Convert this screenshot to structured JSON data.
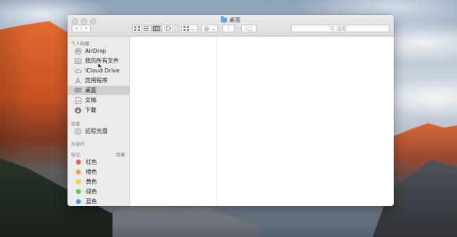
{
  "window": {
    "title": "桌面",
    "search_placeholder": "搜索"
  },
  "toolbar": {
    "back_glyph": "‹",
    "forward_glyph": "›",
    "view_modes": [
      "icon",
      "list",
      "column",
      "cover-flow"
    ],
    "active_view": "column",
    "arrange_chevron": "⌄",
    "action_chevron": "⌄",
    "share_glyph": "⇪"
  },
  "sidebar": {
    "favorites_header": "个人收藏",
    "favorites": [
      {
        "label": "AirDrop",
        "icon": "airdrop-icon"
      },
      {
        "label": "我的所有文件",
        "icon": "all-files-icon"
      },
      {
        "label": "iCloud Drive",
        "icon": "cloud-icon"
      },
      {
        "label": "应用程序",
        "icon": "applications-icon"
      },
      {
        "label": "桌面",
        "icon": "desktop-icon",
        "selected": true
      },
      {
        "label": "文稿",
        "icon": "documents-icon"
      },
      {
        "label": "下载",
        "icon": "downloads-icon"
      }
    ],
    "devices_header": "设备",
    "devices": [
      {
        "label": "远程光盘",
        "icon": "remote-disc-icon"
      }
    ],
    "shared_header": "共享的",
    "tags_header": "标记",
    "tags_hide": "隐藏",
    "tags": [
      {
        "label": "红色",
        "color": "#f25c54"
      },
      {
        "label": "橙色",
        "color": "#f6a13b"
      },
      {
        "label": "黄色",
        "color": "#f5cf3a"
      },
      {
        "label": "绿色",
        "color": "#62c554"
      },
      {
        "label": "蓝色",
        "color": "#3e9bf0"
      }
    ]
  }
}
